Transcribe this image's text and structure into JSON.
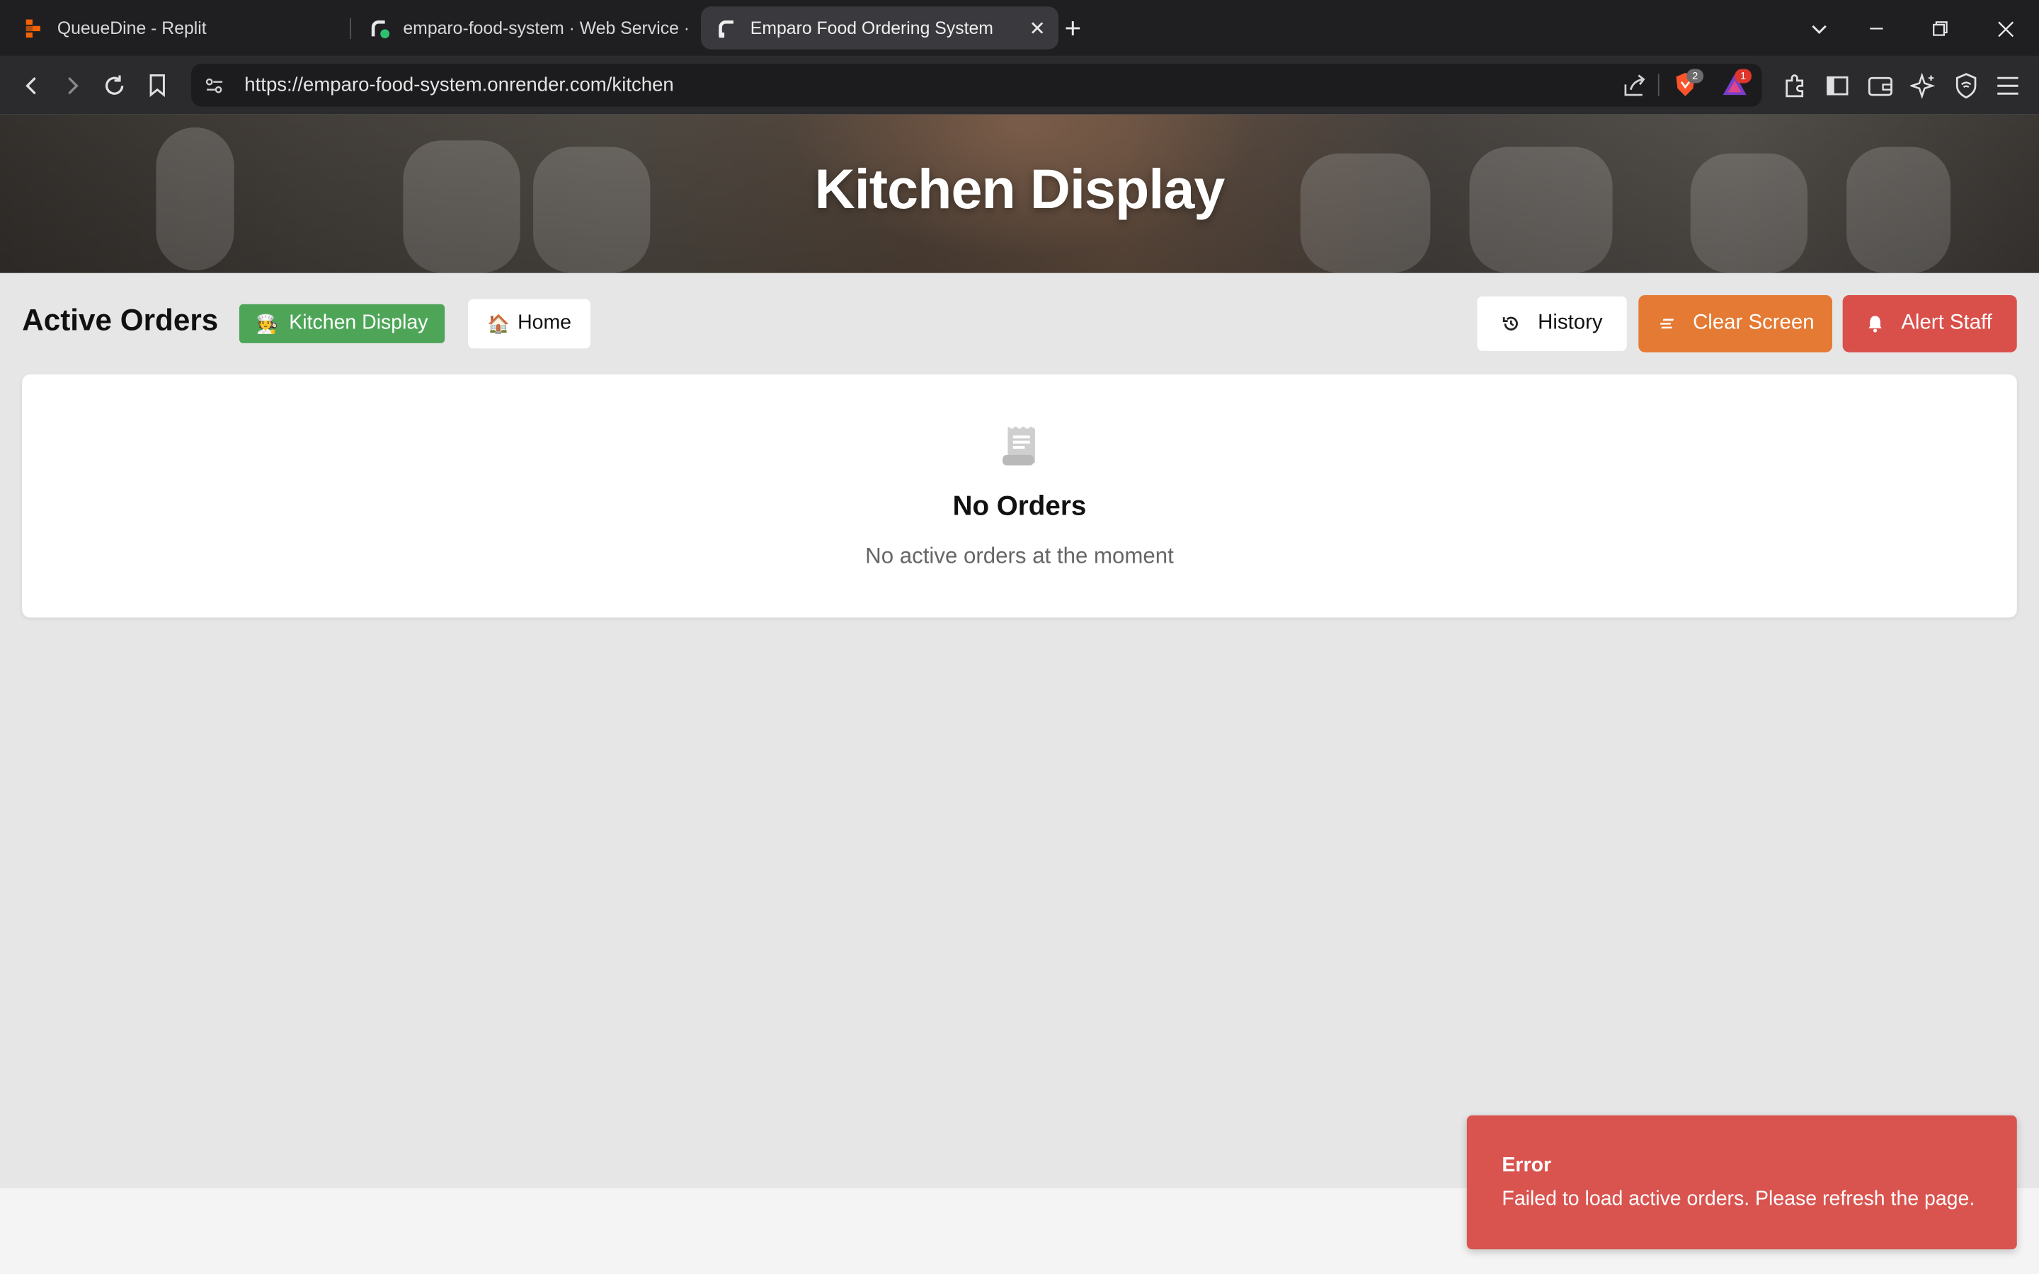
{
  "browser": {
    "tabs": [
      {
        "title": "QueueDine - Replit",
        "active": false
      },
      {
        "title": "emparo-food-system · Web Service ·",
        "active": false
      },
      {
        "title": "Emparo Food Ordering System",
        "active": true
      }
    ],
    "url": "https://emparo-food-system.onrender.com/kitchen",
    "badges": {
      "brave_shield": "2",
      "rewards": "1"
    }
  },
  "hero": {
    "title": "Kitchen Display"
  },
  "header": {
    "section_title": "Active Orders",
    "nav": {
      "kitchen_label": "Kitchen Display",
      "kitchen_emoji": "🧑‍🍳",
      "home_label": "Home",
      "home_emoji": "🏠"
    },
    "actions": {
      "history_label": "History",
      "clear_label": "Clear Screen",
      "alert_label": "Alert Staff"
    }
  },
  "empty_state": {
    "title": "No Orders",
    "subtitle": "No active orders at the moment",
    "icon": "receipt-icon"
  },
  "toast": {
    "title": "Error",
    "message": "Failed to load active orders. Please refresh the page."
  },
  "colors": {
    "green": "#4ea558",
    "orange": "#e47a33",
    "red": "#d9504b",
    "toast": "#d9534f"
  }
}
